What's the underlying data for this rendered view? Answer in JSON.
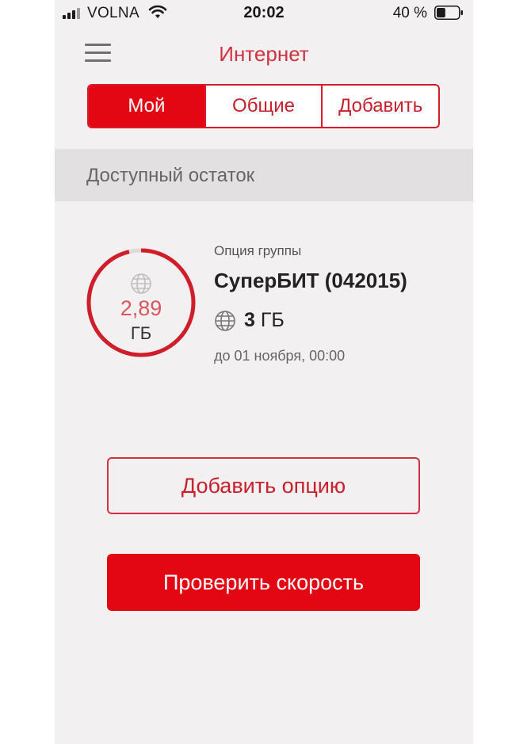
{
  "status_bar": {
    "carrier": "VOLNA",
    "time": "20:02",
    "battery_percent": "40 %",
    "signal_icon": "signal-icon",
    "wifi_icon": "wifi-icon",
    "battery_icon": "battery-icon",
    "battery_level": 0.4
  },
  "nav": {
    "title": "Интернет",
    "menu_icon": "hamburger-icon"
  },
  "tabs": [
    {
      "label": "Мой",
      "active": true
    },
    {
      "label": "Общие",
      "active": false
    },
    {
      "label": "Добавить",
      "active": false
    }
  ],
  "section_title": "Доступный остаток",
  "option": {
    "group_label": "Опция группы",
    "name": "СуперБИТ (042015)",
    "total_amount": "3",
    "total_unit": "ГБ",
    "valid_until": "до 01 ноября, 00:00",
    "remaining_value": "2,89",
    "remaining_unit": "ГБ",
    "remaining_fraction": 0.963,
    "globe_icon": "globe-icon"
  },
  "buttons": {
    "add_option": "Добавить опцию",
    "check_speed": "Проверить скорость"
  },
  "colors": {
    "accent": "#e30613",
    "title": "#d0323f",
    "background": "#f2f0f1",
    "section_bg": "#e2e0e1"
  }
}
